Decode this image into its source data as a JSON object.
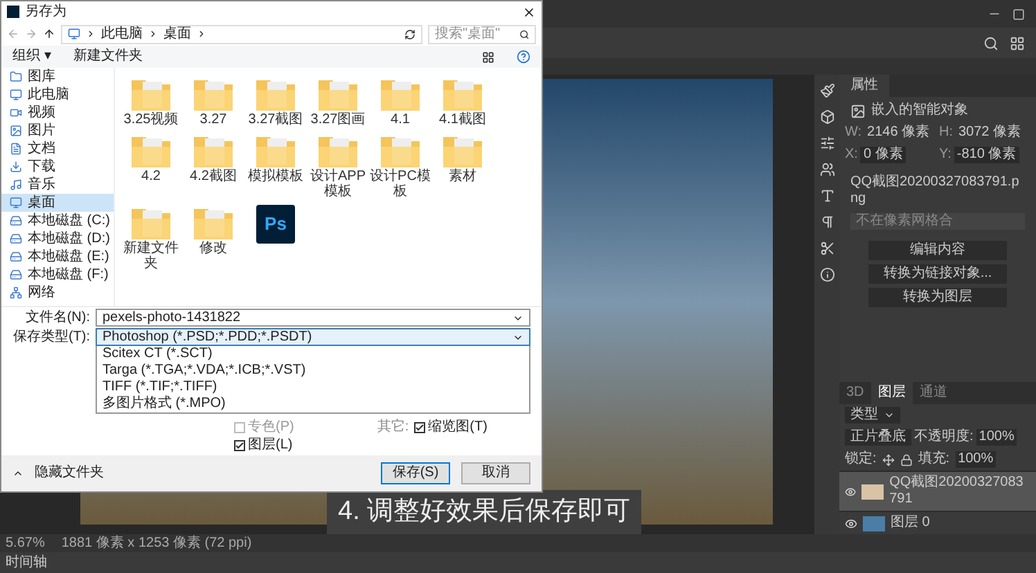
{
  "dialog": {
    "title": "另存为",
    "path": [
      "此电脑",
      "桌面"
    ],
    "search": {
      "placeholder": "搜索\"桌面\""
    },
    "toolbar": [
      "组织 ▾",
      "新建文件夹"
    ],
    "sidebar": [
      {
        "label": "图库",
        "kind": "quick",
        "selected": false
      },
      {
        "label": "此电脑",
        "kind": "pc",
        "selected": false
      },
      {
        "label": "视频",
        "kind": "videos",
        "selected": false
      },
      {
        "label": "图片",
        "kind": "pictures",
        "selected": false
      },
      {
        "label": "文档",
        "kind": "documents",
        "selected": false
      },
      {
        "label": "下载",
        "kind": "downloads",
        "selected": false
      },
      {
        "label": "音乐",
        "kind": "music",
        "selected": false
      },
      {
        "label": "桌面",
        "kind": "desktop",
        "selected": true
      },
      {
        "label": "本地磁盘 (C:)",
        "kind": "drive",
        "selected": false
      },
      {
        "label": "本地磁盘 (D:)",
        "kind": "drive",
        "selected": false
      },
      {
        "label": "本地磁盘 (E:)",
        "kind": "drive",
        "selected": false
      },
      {
        "label": "本地磁盘 (F:)",
        "kind": "drive",
        "selected": false
      },
      {
        "label": "网络",
        "kind": "network",
        "selected": false
      }
    ],
    "files": [
      {
        "name": "3.25视频",
        "kind": "folder"
      },
      {
        "name": "3.27",
        "kind": "folder"
      },
      {
        "name": "3.27截图",
        "kind": "folder"
      },
      {
        "name": "3.27图画",
        "kind": "folder"
      },
      {
        "name": "4.1",
        "kind": "folder"
      },
      {
        "name": "4.1截图",
        "kind": "folder"
      },
      {
        "name": "4.2",
        "kind": "folder"
      },
      {
        "name": "4.2截图",
        "kind": "folder"
      },
      {
        "name": "模拟模板",
        "kind": "folder"
      },
      {
        "name": "设计APP模板",
        "kind": "folder"
      },
      {
        "name": "设计PC模板",
        "kind": "folder"
      },
      {
        "name": "素材",
        "kind": "folder"
      },
      {
        "name": "新建文件夹",
        "kind": "folder"
      },
      {
        "name": "修改",
        "kind": "folder"
      },
      {
        "name": "Ps",
        "kind": "psd"
      }
    ],
    "filename": {
      "label": "文件名(N):",
      "value": "pexels-photo-1431822"
    },
    "filetype": {
      "label": "保存类型(T):",
      "value": "Photoshop (*.PSD;*.PDD;*.PSDT)",
      "options": [
        "Scitex CT (*.SCT)",
        "Targa (*.TGA;*.VDA;*.ICB;*.VST)",
        "TIFF (*.TIF;*.TIFF)",
        "多图片格式 (*.MPO)"
      ]
    },
    "options": [
      {
        "label": "专色(P)",
        "checked": false
      },
      {
        "label": "缩览图(T)",
        "checked": true
      },
      {
        "label": "图层(L)",
        "checked": true
      }
    ],
    "other_label": "其它:",
    "hide_folders": "隐藏文件夹",
    "buttons": [
      "保存(S)",
      "取消"
    ]
  },
  "caption": "4. 调整好效果后保存即可",
  "properties": {
    "tab": "属性",
    "type": "嵌入的智能对象",
    "fields": [
      {
        "label": "W:",
        "value": "2146 像素"
      },
      {
        "label": "H:",
        "value": "3072 像素"
      },
      {
        "label": "X:",
        "value": "0 像素"
      },
      {
        "label": "Y:",
        "value": "-810 像素"
      }
    ],
    "file": "QQ截图20200327083791.png",
    "placeholder": "不在像素网格合",
    "buttons": [
      "编辑内容",
      "转换为链接对象...",
      "转换为图层"
    ]
  },
  "layers_panel": {
    "tabs": [
      {
        "label": "3D",
        "selected": false
      },
      {
        "label": "图层",
        "selected": true
      },
      {
        "label": "通道",
        "selected": false
      }
    ],
    "filter": "类型",
    "blend": "正片叠底",
    "opacity_label": "不透明度:",
    "opacity": "100%",
    "lock_label": "锁定:",
    "fill_label": "填充:",
    "fill": "100%",
    "layers": [
      {
        "name": "QQ截图20200327083791",
        "selected": true,
        "visible": true
      },
      {
        "name": "图层 0",
        "selected": false,
        "visible": true
      }
    ]
  },
  "status_bar": {
    "zoom": "5.67%",
    "size": "1881 像素 x 1253 像素 (72 ppi)"
  },
  "timeline": "时间轴"
}
